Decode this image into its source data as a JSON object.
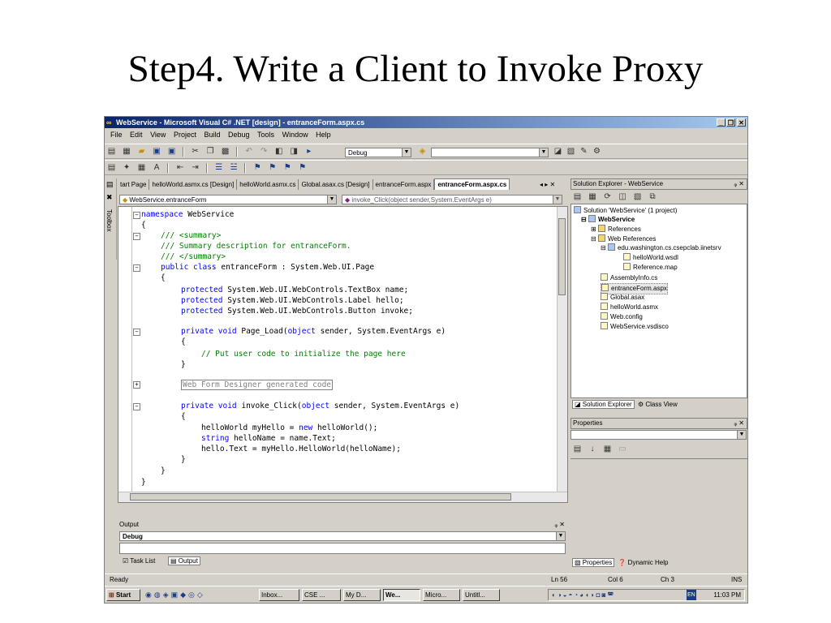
{
  "slide": {
    "title": "Step4. Write a Client to Invoke Proxy"
  },
  "window": {
    "title": "WebService - Microsoft Visual C# .NET [design] - entranceForm.aspx.cs"
  },
  "menu": [
    "File",
    "Edit",
    "View",
    "Project",
    "Build",
    "Debug",
    "Tools",
    "Window",
    "Help"
  ],
  "toolbar": {
    "config": "Debug",
    "find_value": ""
  },
  "sidebar": {
    "toolbox_label": "Toolbox"
  },
  "tabs": [
    "tart Page",
    "helloWorld.asmx.cs [Design]",
    "helloWorld.asmx.cs",
    "Global.asax.cs [Design]",
    "entranceForm.aspx",
    "entranceForm.aspx.cs"
  ],
  "active_tab": "entranceForm.aspx.cs",
  "tab_controls": "◂ ▸ ✕",
  "editor": {
    "class_combo": "WebService.entranceForm",
    "member_combo": "invoke_Click(object sender,System.EventArgs e)",
    "lines": [
      {
        "kw": "namespace",
        "rest": " WebService"
      },
      {
        "rest": "{"
      },
      {
        "cm": "/// <summary>"
      },
      {
        "cm": "/// Summary description for entranceForm."
      },
      {
        "cm": "/// </summary>"
      },
      {
        "kw": "public class",
        "rest": " entranceForm : System.Web.UI.Page"
      },
      {
        "rest": "{"
      },
      {
        "kw": "protected",
        "rest": " System.Web.UI.WebControls.TextBox name;"
      },
      {
        "kw": "protected",
        "rest": " System.Web.UI.WebControls.Label hello;"
      },
      {
        "kw": "protected",
        "rest": " System.Web.UI.WebControls.Button invoke;"
      },
      {
        "pre": "private void",
        "mid": " Page_Load(",
        "kw2": "object",
        "end": " sender, System.EventArgs e)"
      },
      {
        "rest": "{"
      },
      {
        "cm": "// Put user code to initialize the page here"
      },
      {
        "rest": "}"
      },
      {
        "region": "Web Form Designer generated code"
      },
      {
        "pre": "private void",
        "mid": " invoke_Click(",
        "kw2": "object",
        "end": " sender, System.EventArgs e)"
      },
      {
        "rest": "{"
      },
      {
        "rest": "helloWorld myHello = ",
        "kw": "new",
        "end": " helloWorld();"
      },
      {
        "kw": "string",
        "rest": " helloName = name.Text;"
      },
      {
        "rest": "hello.Text = myHello.HelloWorld(helloName);"
      },
      {
        "rest": "}"
      },
      {
        "rest": "}"
      },
      {
        "rest": "}"
      }
    ]
  },
  "output": {
    "title": "Output",
    "pane": "Debug",
    "pin": "ᵩ ✕"
  },
  "bottom_tabs": {
    "task_list": "Task List",
    "output": "Output"
  },
  "solution_explorer": {
    "title": "Solution Explorer - WebService",
    "pin": "ᵩ ✕",
    "items": [
      "Solution 'WebService' (1 project)",
      "WebService",
      "References",
      "Web References",
      "edu.washington.cs.csepclab.iinetsrv",
      "helloWorld.wsdl",
      "Reference.map",
      "AssemblyInfo.cs",
      "entranceForm.aspx",
      "Global.asax",
      "helloWorld.asmx",
      "Web.config",
      "WebService.vsdisco"
    ],
    "tab_solution": "Solution Explorer",
    "tab_class": "Class View"
  },
  "properties": {
    "title": "Properties",
    "pin": "ᵩ ✕",
    "tab_props": "Properties",
    "tab_help": "Dynamic Help"
  },
  "status": {
    "ready": "Ready",
    "ln": "Ln 56",
    "col": "Col 6",
    "ch": "Ch 3",
    "ins": "INS"
  },
  "taskbar": {
    "start": "Start",
    "buttons": [
      "Inbox...",
      "CSE ...",
      "My D...",
      "We...",
      "Micro...",
      "Untitl..."
    ],
    "active_index": 3,
    "clock": "11:03 PM",
    "lang": "EN"
  }
}
